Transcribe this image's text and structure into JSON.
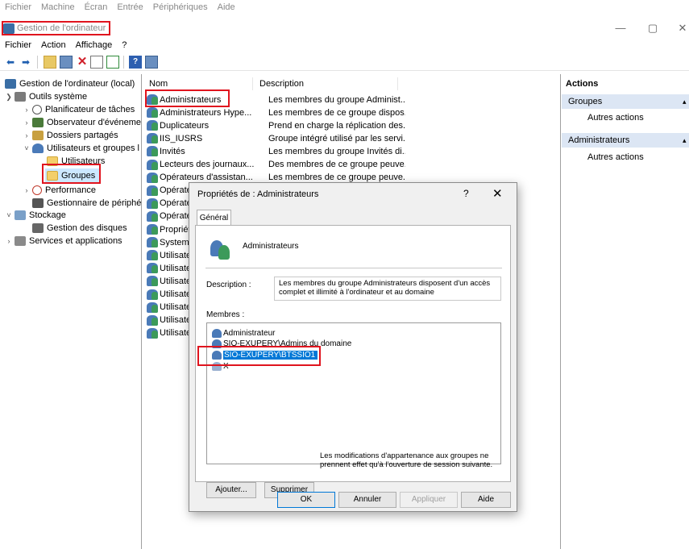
{
  "vm_menu": [
    "Fichier",
    "Machine",
    "Écran",
    "Entrée",
    "Périphériques",
    "Aide"
  ],
  "window": {
    "title": "Gestion de l'ordinateur",
    "controls": {
      "minimize": "—",
      "maximize": "▢",
      "close": "✕"
    }
  },
  "app_menu": [
    "Fichier",
    "Action",
    "Affichage",
    "?"
  ],
  "toolbar_icons": [
    "back-arrow-icon",
    "forward-arrow-icon",
    "up-folder-icon",
    "show-hide-tree-icon",
    "delete-icon",
    "properties-icon",
    "export-list-icon",
    "help-icon",
    "show-hide-action-pane-icon"
  ],
  "tree": {
    "root": "Gestion de l'ordinateur (local)",
    "system_tools": "Outils système",
    "task_scheduler": "Planificateur de tâches",
    "event_viewer": "Observateur d'événeme",
    "shared_folders": "Dossiers partagés",
    "local_users": "Utilisateurs et groupes l",
    "users": "Utilisateurs",
    "groups": "Groupes",
    "performance": "Performance",
    "device_manager": "Gestionnaire de périphé",
    "storage": "Stockage",
    "disk_management": "Gestion des disques",
    "services": "Services et applications"
  },
  "list": {
    "col_name": "Nom",
    "col_desc": "Description",
    "rows": [
      {
        "name": "Administrateurs",
        "desc": "Les membres du groupe Administ..."
      },
      {
        "name": "Administrateurs Hype...",
        "desc": "Les membres de ce groupe dispos..."
      },
      {
        "name": "Duplicateurs",
        "desc": "Prend en charge la réplication des..."
      },
      {
        "name": "IIS_IUSRS",
        "desc": "Groupe intégré utilisé par les servi..."
      },
      {
        "name": "Invités",
        "desc": "Les membres du groupe Invités di..."
      },
      {
        "name": "Lecteurs des journaux...",
        "desc": "Des membres de ce groupe peuve..."
      },
      {
        "name": "Opérateurs d'assistan...",
        "desc": "Les membres de ce groupe peuve..."
      },
      {
        "name": "Opérate",
        "desc": ""
      },
      {
        "name": "Opérate",
        "desc": ""
      },
      {
        "name": "Opérate",
        "desc": ""
      },
      {
        "name": "Propriét",
        "desc": ""
      },
      {
        "name": "System",
        "desc": ""
      },
      {
        "name": "Utilisate",
        "desc": ""
      },
      {
        "name": "Utilisate",
        "desc": ""
      },
      {
        "name": "Utilisate",
        "desc": ""
      },
      {
        "name": "Utilisate",
        "desc": ""
      },
      {
        "name": "Utilisate",
        "desc": ""
      },
      {
        "name": "Utilisate",
        "desc": ""
      },
      {
        "name": "Utilisate",
        "desc": ""
      }
    ]
  },
  "actions": {
    "header": "Actions",
    "section1": "Groupes",
    "section1_item": "Autres actions",
    "section2": "Administrateurs",
    "section2_item": "Autres actions",
    "collapse_arrow": "▴"
  },
  "dialog": {
    "title": "Propriétés de : Administrateurs",
    "help": "?",
    "close": "✕",
    "tab": "Général",
    "group_name": "Administrateurs",
    "description_label": "Description :",
    "description": "Les membres du groupe Administrateurs disposent d'un accès complet et illimité à l'ordinateur et au domaine",
    "members_label": "Membres :",
    "members": [
      "Administrateur",
      "SIO-EXUPERY\\Admins du domaine",
      "SIO-EXUPERY\\BTSSIO1",
      "X"
    ],
    "add": "Ajouter...",
    "remove": "Supprimer",
    "note": "Les modifications d'appartenance aux groupes ne prennent effet qu'à l'ouverture de session suivante.",
    "ok": "OK",
    "cancel": "Annuler",
    "apply": "Appliquer",
    "help_btn": "Aide"
  }
}
